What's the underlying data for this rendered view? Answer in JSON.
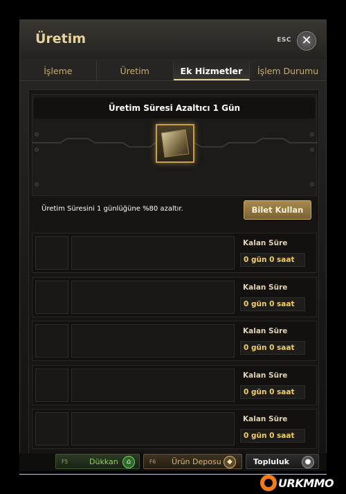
{
  "window": {
    "title": "Üretim",
    "esc_label": "ESC",
    "close_symbol": "✕"
  },
  "tabs": [
    {
      "label": "İşleme",
      "active": false
    },
    {
      "label": "Üretim",
      "active": false
    },
    {
      "label": "Ek Hizmetler",
      "active": true
    },
    {
      "label": "İşlem Durumu",
      "active": false
    }
  ],
  "service": {
    "title": "Üretim Süresi Azaltıcı 1 Gün",
    "item_icon": "ticket-scroll-icon",
    "description": "Üretim Süresini 1 günlüğüne %80 azaltır.",
    "use_button": "Bilet Kullan"
  },
  "slots": [
    {
      "time_label": "Kalan Süre",
      "time_value": "0 gün 0 saat"
    },
    {
      "time_label": "Kalan Süre",
      "time_value": "0 gün 0 saat"
    },
    {
      "time_label": "Kalan Süre",
      "time_value": "0 gün 0 saat"
    },
    {
      "time_label": "Kalan Süre",
      "time_value": "0 gün 0 saat"
    },
    {
      "time_label": "Kalan Süre",
      "time_value": "0 gün 0 saat"
    }
  ],
  "bottom": {
    "shop": {
      "key": "F5",
      "label": "Dükkan",
      "icon": "shop-icon"
    },
    "depot": {
      "key": "F6",
      "label": "Ürün Deposu",
      "icon": "gem-icon"
    },
    "community": {
      "label": "Topluluk",
      "icon": "people-icon"
    }
  },
  "watermark": {
    "text": "URKMMO"
  },
  "colors": {
    "title_gold": "#e8d39a",
    "tab_gold": "#c6ad72",
    "time_yellow": "#f0d060",
    "button_bronze": "#a88a4e",
    "shop_green": "#8ed062"
  }
}
